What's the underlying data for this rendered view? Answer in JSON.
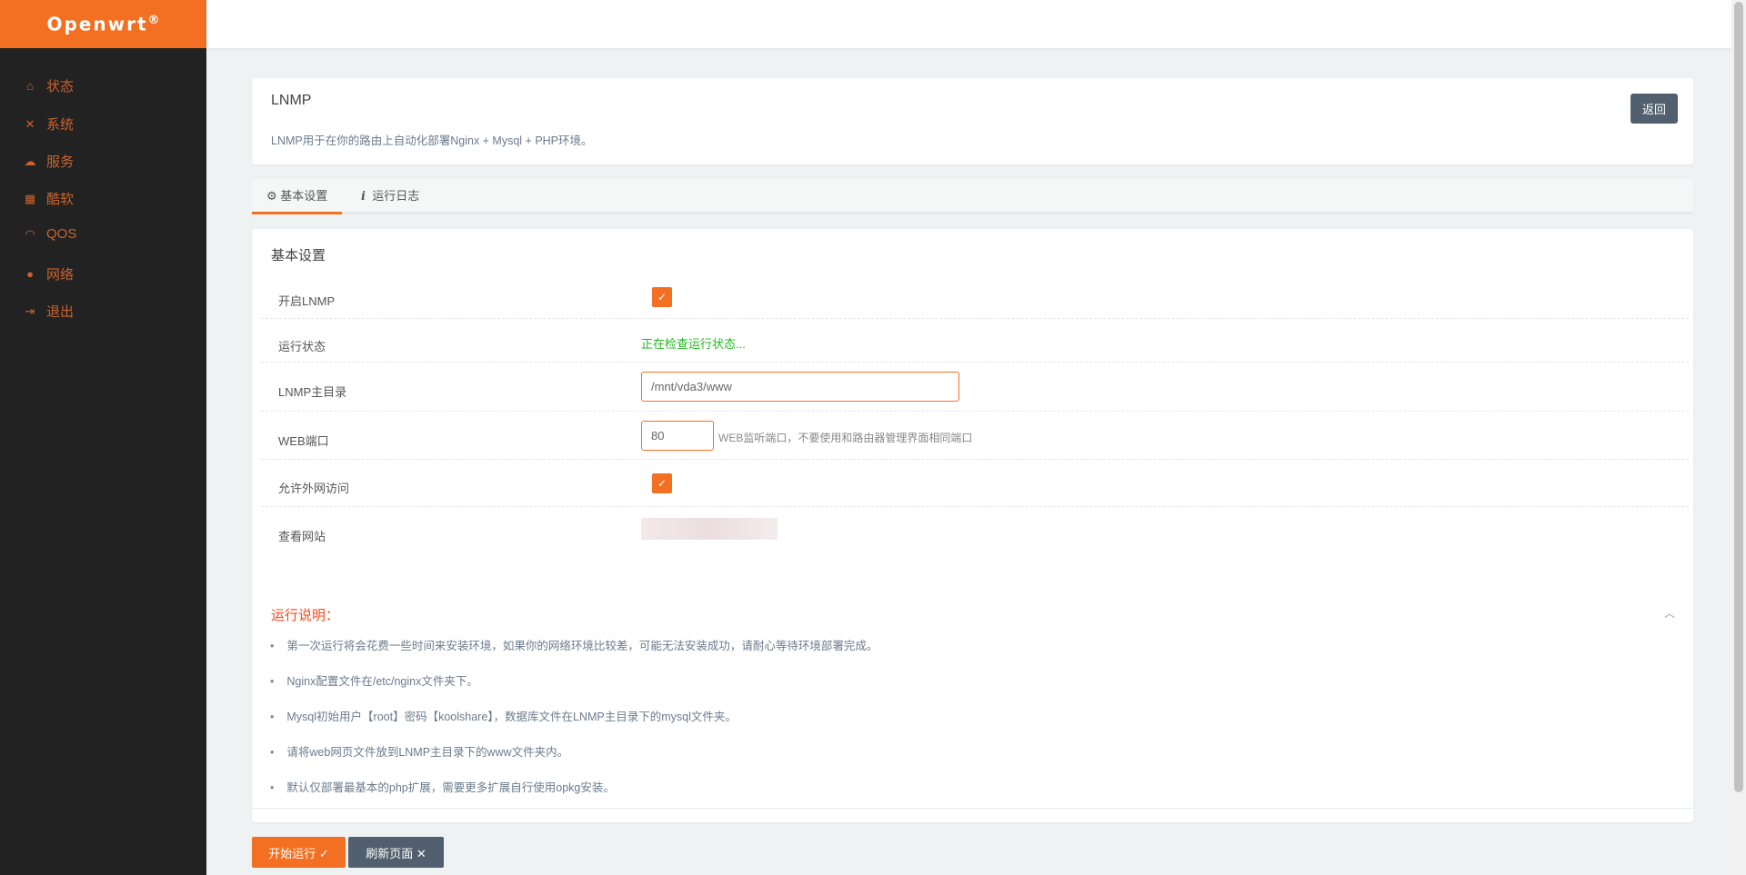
{
  "brand": {
    "name": "Openwrt",
    "mark": "®"
  },
  "sidebar": {
    "items": [
      {
        "label": "状态",
        "icon": "home-icon"
      },
      {
        "label": "系统",
        "icon": "tools-icon"
      },
      {
        "label": "服务",
        "icon": "cloud-download-icon"
      },
      {
        "label": "酷软",
        "icon": "calendar-icon"
      },
      {
        "label": "QOS",
        "icon": "gauge-icon"
      },
      {
        "label": "网络",
        "icon": "globe-icon"
      },
      {
        "label": "退出",
        "icon": "sign-out-icon"
      }
    ]
  },
  "header": {
    "title": "LNMP",
    "description": "LNMP用于在你的路由上自动化部署Nginx + Mysql + PHP环境。",
    "back_label": "返回"
  },
  "tabs": [
    {
      "label": "基本设置",
      "icon": "gear-icon",
      "active": true
    },
    {
      "label": "运行日志",
      "icon": "info-icon",
      "active": false
    }
  ],
  "settings": {
    "title": "基本设置",
    "enable_label": "开启LNMP",
    "enable_checked": true,
    "status_label": "运行状态",
    "status_value": "正在检查运行状态...",
    "status_color": "#22b81f",
    "dir_label": "LNMP主目录",
    "dir_value": "/mnt/vda3/www",
    "port_label": "WEB端口",
    "port_value": "80",
    "port_help": "WEB监听端口，不要使用和路由器管理界面相同端口",
    "wan_label": "允许外网访问",
    "wan_checked": true,
    "site_label": "查看网站"
  },
  "notes": {
    "title": "运行说明：",
    "items": [
      "第一次运行将会花费一些时间来安装环境，如果你的网络环境比较差，可能无法安装成功，请耐心等待环境部署完成。",
      "Nginx配置文件在/etc/nginx文件夹下。",
      "Mysql初始用户【root】密码【koolshare】，数据库文件在LNMP主目录下的mysql文件夹。",
      "请将web网页文件放到LNMP主目录下的www文件夹内。",
      "默认仅部署最基本的php扩展，需要更多扩展自行使用opkg安装。"
    ]
  },
  "actions": {
    "start_label": "开始运行 ✓",
    "refresh_label": "刷新页面 ✕"
  },
  "colors": {
    "accent": "#f36f21",
    "sidebar": "#222222",
    "dark_button": "#515f6e"
  }
}
